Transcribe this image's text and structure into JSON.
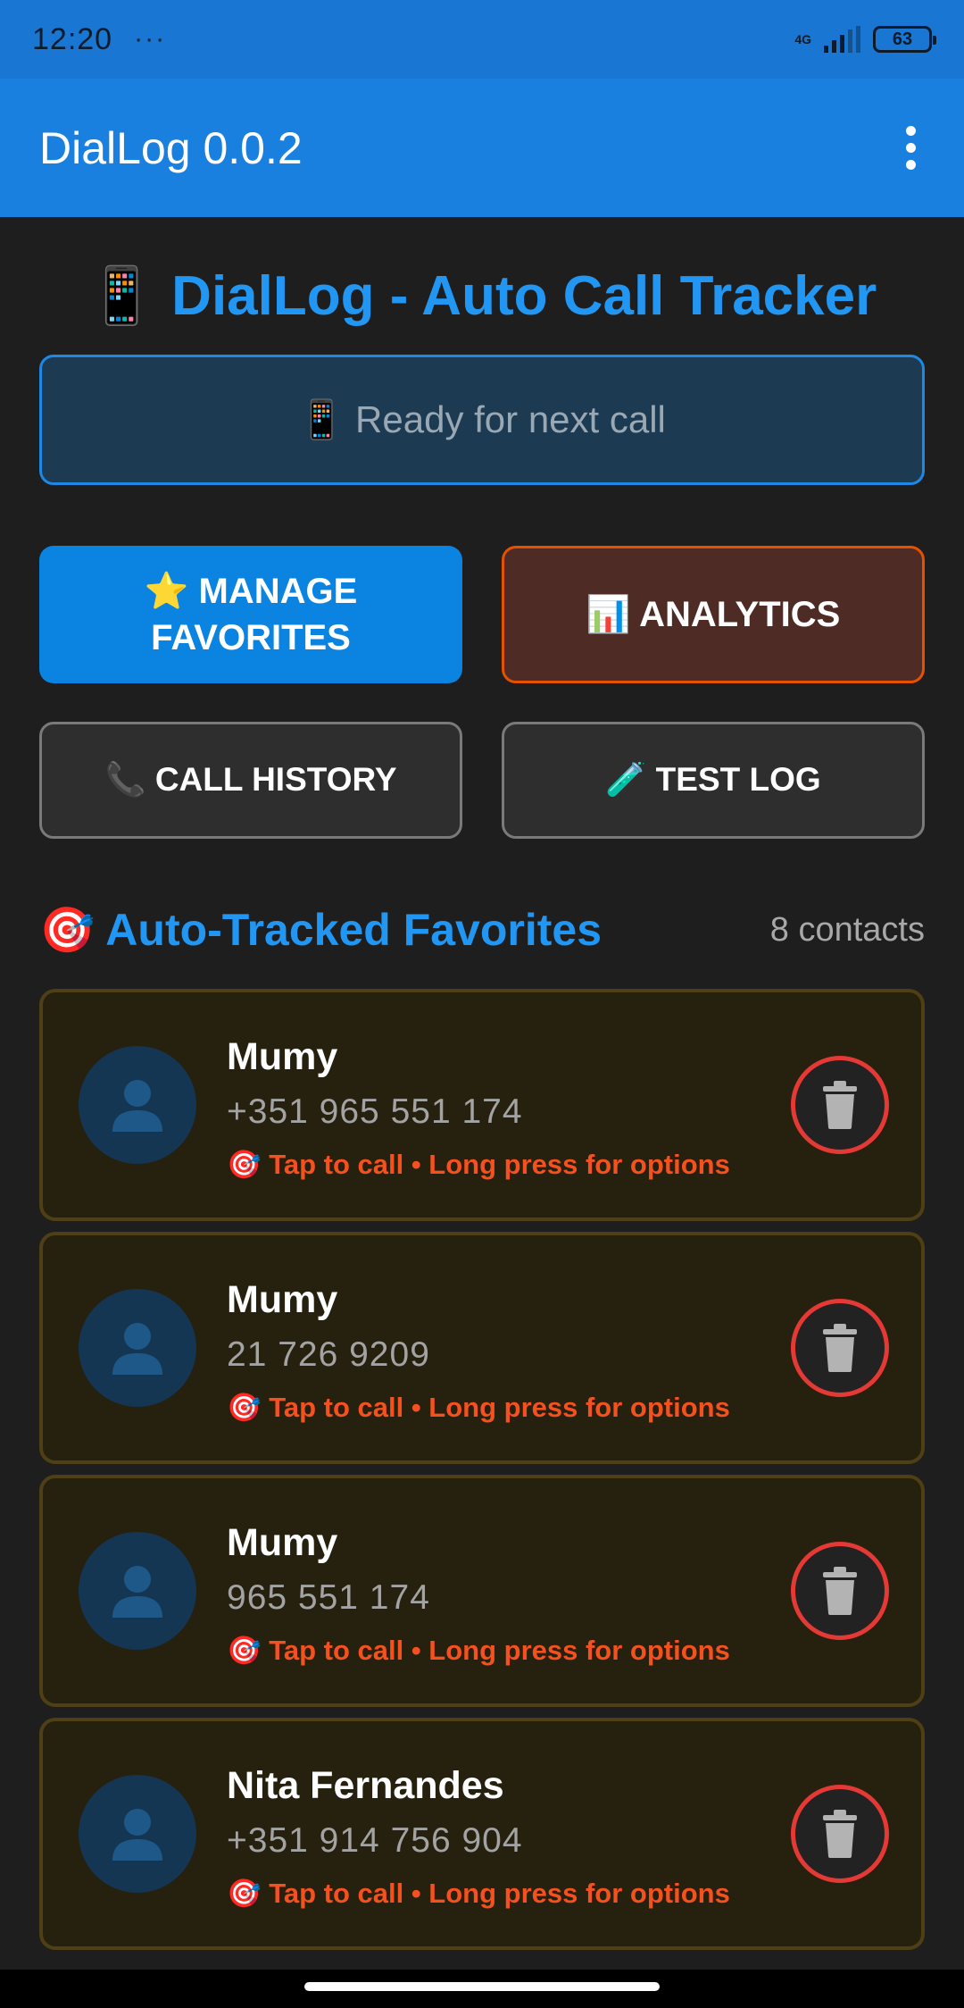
{
  "status_bar": {
    "time": "12:20",
    "dots": "···",
    "network": "4G",
    "battery": "63"
  },
  "app_bar": {
    "title": "DialLog 0.0.2"
  },
  "main": {
    "heading_emoji": "📱",
    "heading": "DialLog - Auto Call Tracker",
    "status_text": "📱 Ready for next call",
    "buttons": {
      "manage_favorites": "⭐ MANAGE FAVORITES",
      "analytics": "📊 ANALYTICS",
      "call_history": "📞 CALL HISTORY",
      "test_log": "🧪 TEST LOG"
    },
    "section": {
      "title": "🎯 Auto-Tracked Favorites",
      "count": "8 contacts"
    },
    "contacts": [
      {
        "name": "Mumy",
        "phone": "+351 965 551 174",
        "hint": "🎯 Tap to call • Long press for options"
      },
      {
        "name": "Mumy",
        "phone": "21 726 9209",
        "hint": "🎯 Tap to call • Long press for options"
      },
      {
        "name": "Mumy",
        "phone": "965 551 174",
        "hint": "🎯 Tap to call • Long press for options"
      },
      {
        "name": "Nita Fernandes",
        "phone": "+351 914 756 904",
        "hint": "🎯 Tap to call • Long press for options"
      }
    ]
  },
  "colors": {
    "accent": "#2196f3",
    "app_bar": "#1a80df",
    "danger": "#e53935",
    "hint": "#f4511e"
  },
  "icons": {
    "avatar": "person-icon",
    "delete": "trash-icon",
    "menu": "more-vert-icon"
  }
}
